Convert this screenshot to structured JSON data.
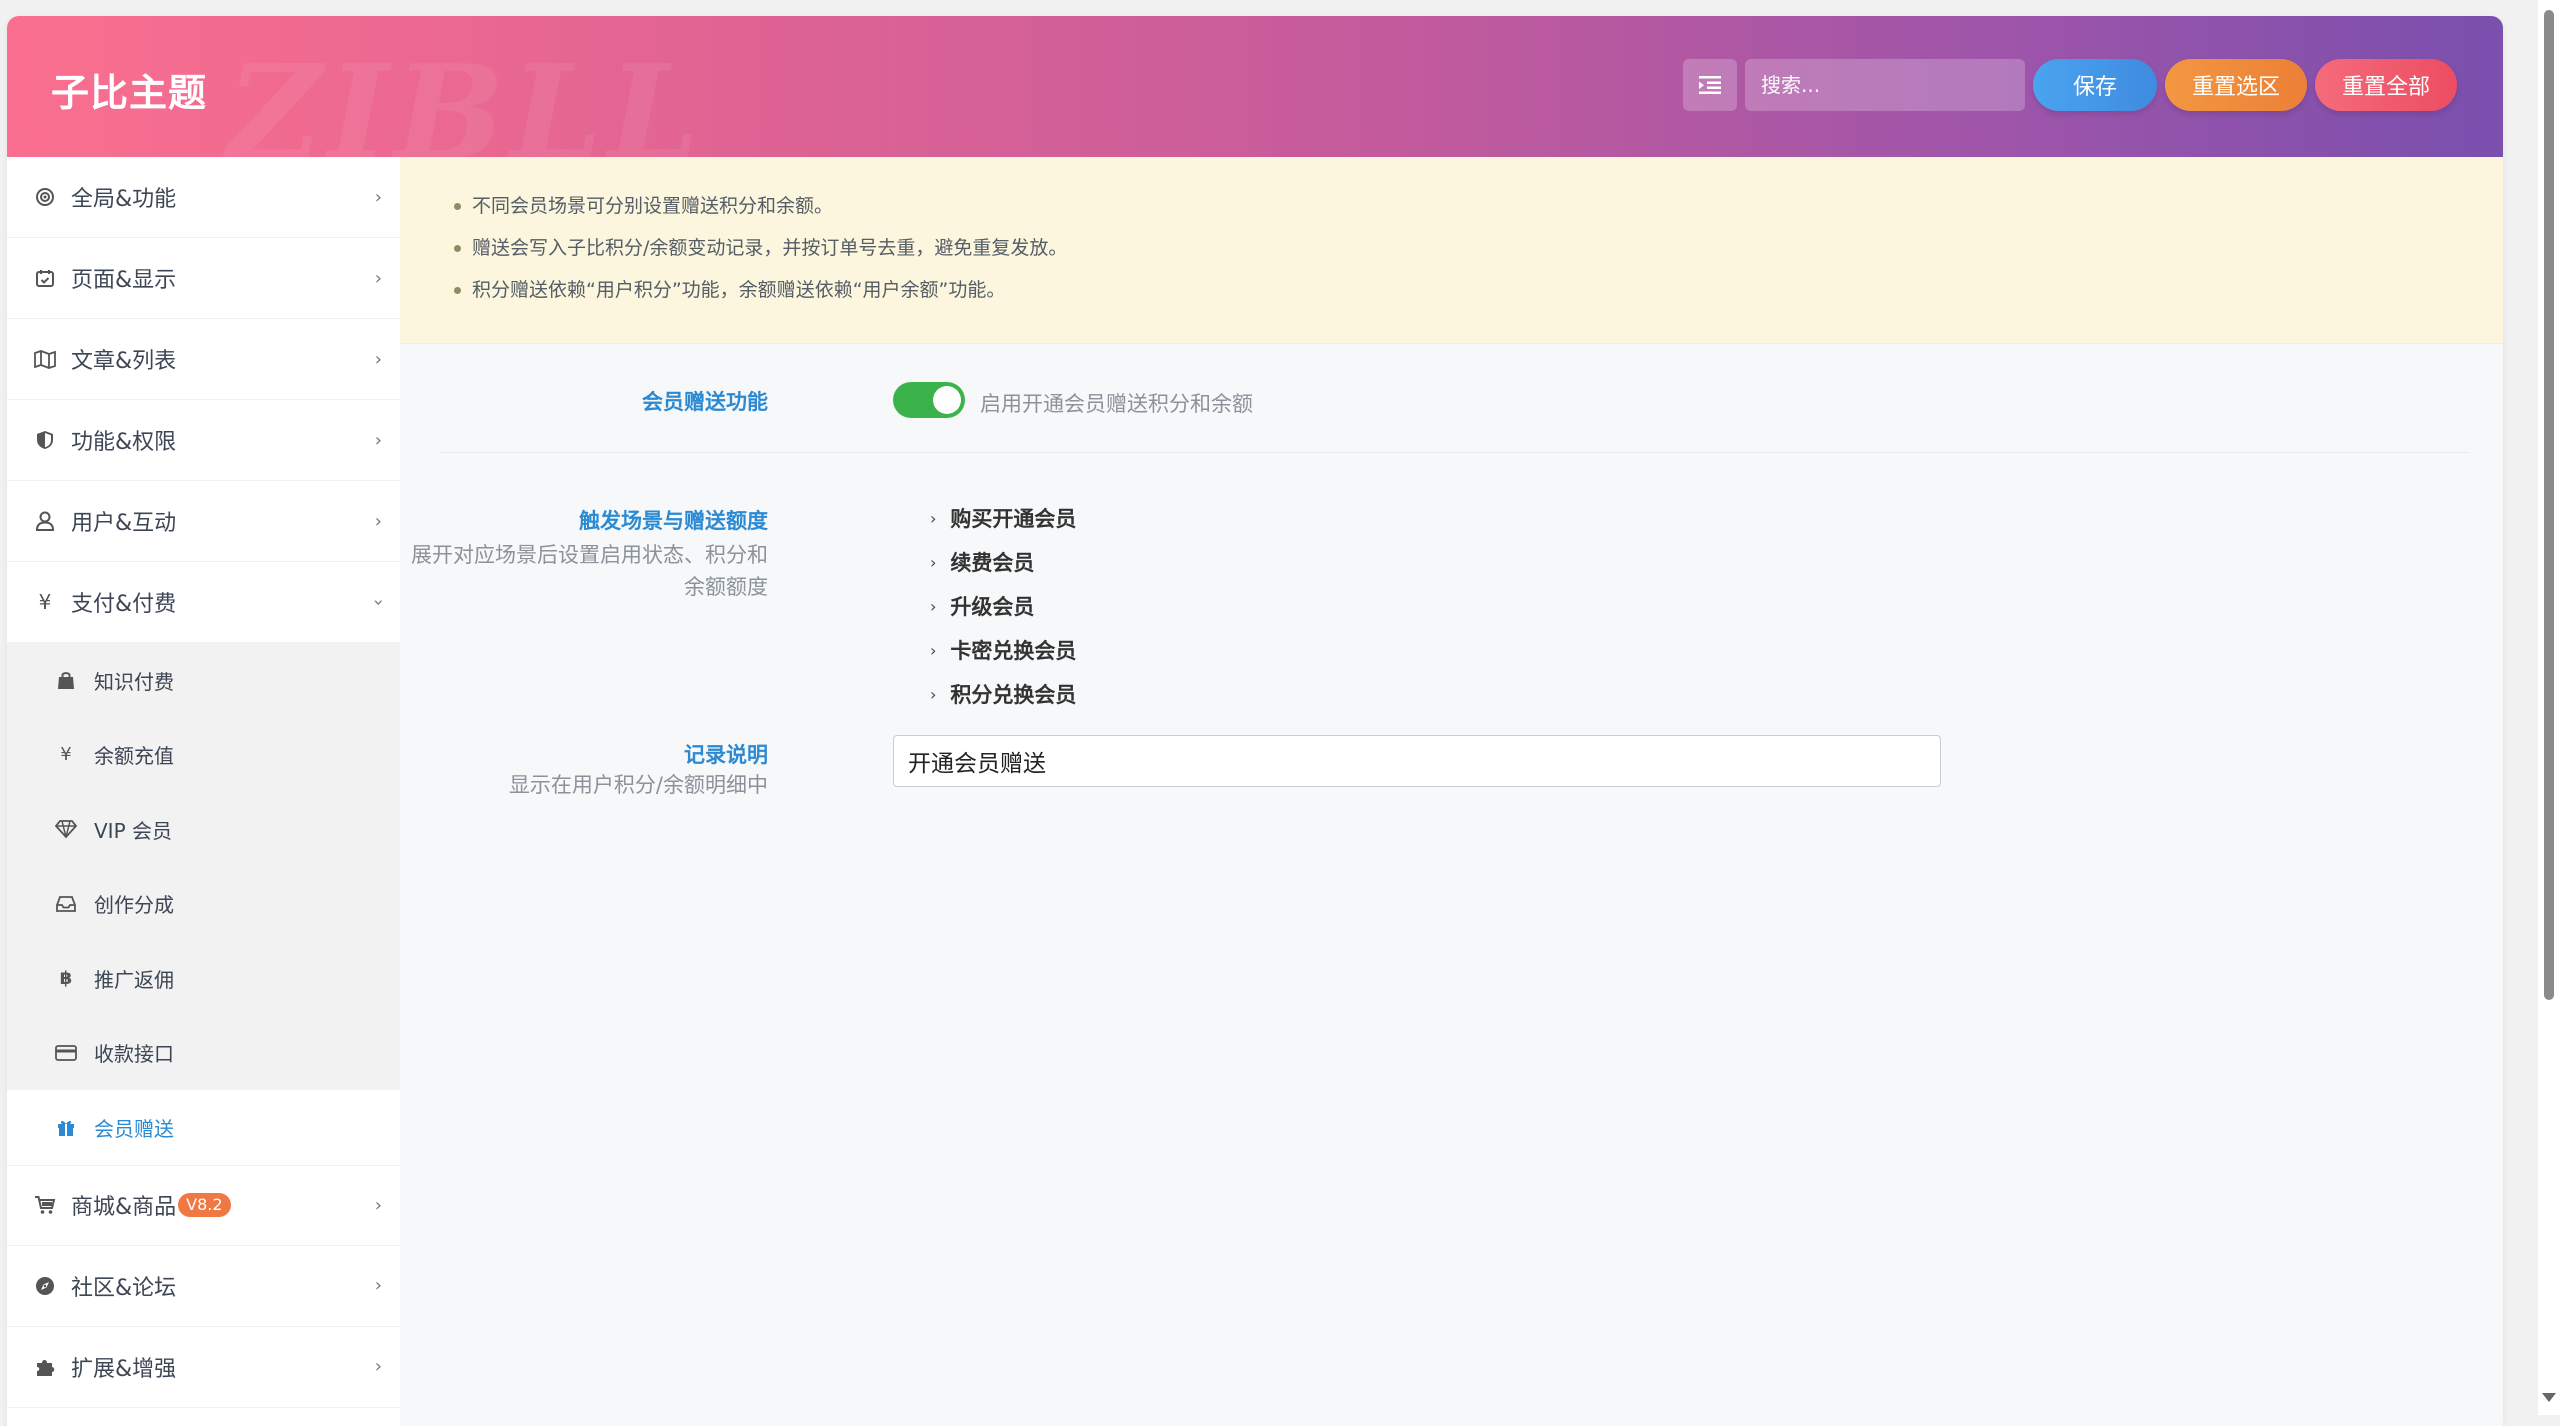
{
  "header": {
    "brand": "子比主题",
    "watermark": "ZIBLL",
    "search_placeholder": "搜索...",
    "save_label": "保存",
    "reset_selection_label": "重置选区",
    "reset_all_label": "重置全部"
  },
  "sidebar": {
    "items": [
      {
        "label": "全局&功能",
        "icon": "target-icon"
      },
      {
        "label": "页面&显示",
        "icon": "calendar-icon"
      },
      {
        "label": "文章&列表",
        "icon": "map-icon"
      },
      {
        "label": "功能&权限",
        "icon": "shield-icon"
      },
      {
        "label": "用户&互动",
        "icon": "user-icon"
      },
      {
        "label": "支付&付费",
        "icon": "yen-icon",
        "expanded": true
      }
    ],
    "sub_items": [
      {
        "label": "知识付费",
        "icon": "shopping-bag-icon"
      },
      {
        "label": "余额充值",
        "icon": "yen-icon"
      },
      {
        "label": "VIP 会员",
        "icon": "diamond-icon"
      },
      {
        "label": "创作分成",
        "icon": "inbox-icon"
      },
      {
        "label": "推广返佣",
        "icon": "bitcoin-icon"
      },
      {
        "label": "收款接口",
        "icon": "credit-card-icon"
      },
      {
        "label": "会员赠送",
        "icon": "gift-icon",
        "active": true
      }
    ],
    "items_after": [
      {
        "label": "商城&商品",
        "icon": "cart-icon",
        "badge": "V8.2"
      },
      {
        "label": "社区&论坛",
        "icon": "compass-icon"
      },
      {
        "label": "扩展&增强",
        "icon": "puzzle-icon"
      }
    ]
  },
  "notice": {
    "lines": [
      "不同会员场景可分别设置赠送积分和余额。",
      "赠送会写入子比积分/余额变动记录，并按订单号去重，避免重复发放。",
      "积分赠送依赖“用户积分”功能，余额赠送依赖“用户余额”功能。"
    ]
  },
  "fields": {
    "gift_enable": {
      "label": "会员赠送功能",
      "toggle_on": true,
      "toggle_text": "启用开通会员赠送积分和余额"
    },
    "scenarios": {
      "label": "触发场景与赠送额度",
      "desc_line1": "展开对应场景后设置启用状态、积分和",
      "desc_line2": "余额额度",
      "items": [
        "购买开通会员",
        "续费会员",
        "升级会员",
        "卡密兑换会员",
        "积分兑换会员"
      ]
    },
    "record_note": {
      "label": "记录说明",
      "desc": "显示在用户积分/余额明细中",
      "value": "开通会员赠送"
    }
  },
  "colors": {
    "accent": "#2c8ad3",
    "toggle_on": "#3cb34a",
    "notice_bg": "#fbf6dd",
    "save": "#4aa4ef",
    "reset_selection": "#f29742",
    "reset_all": "#ec4d62"
  }
}
